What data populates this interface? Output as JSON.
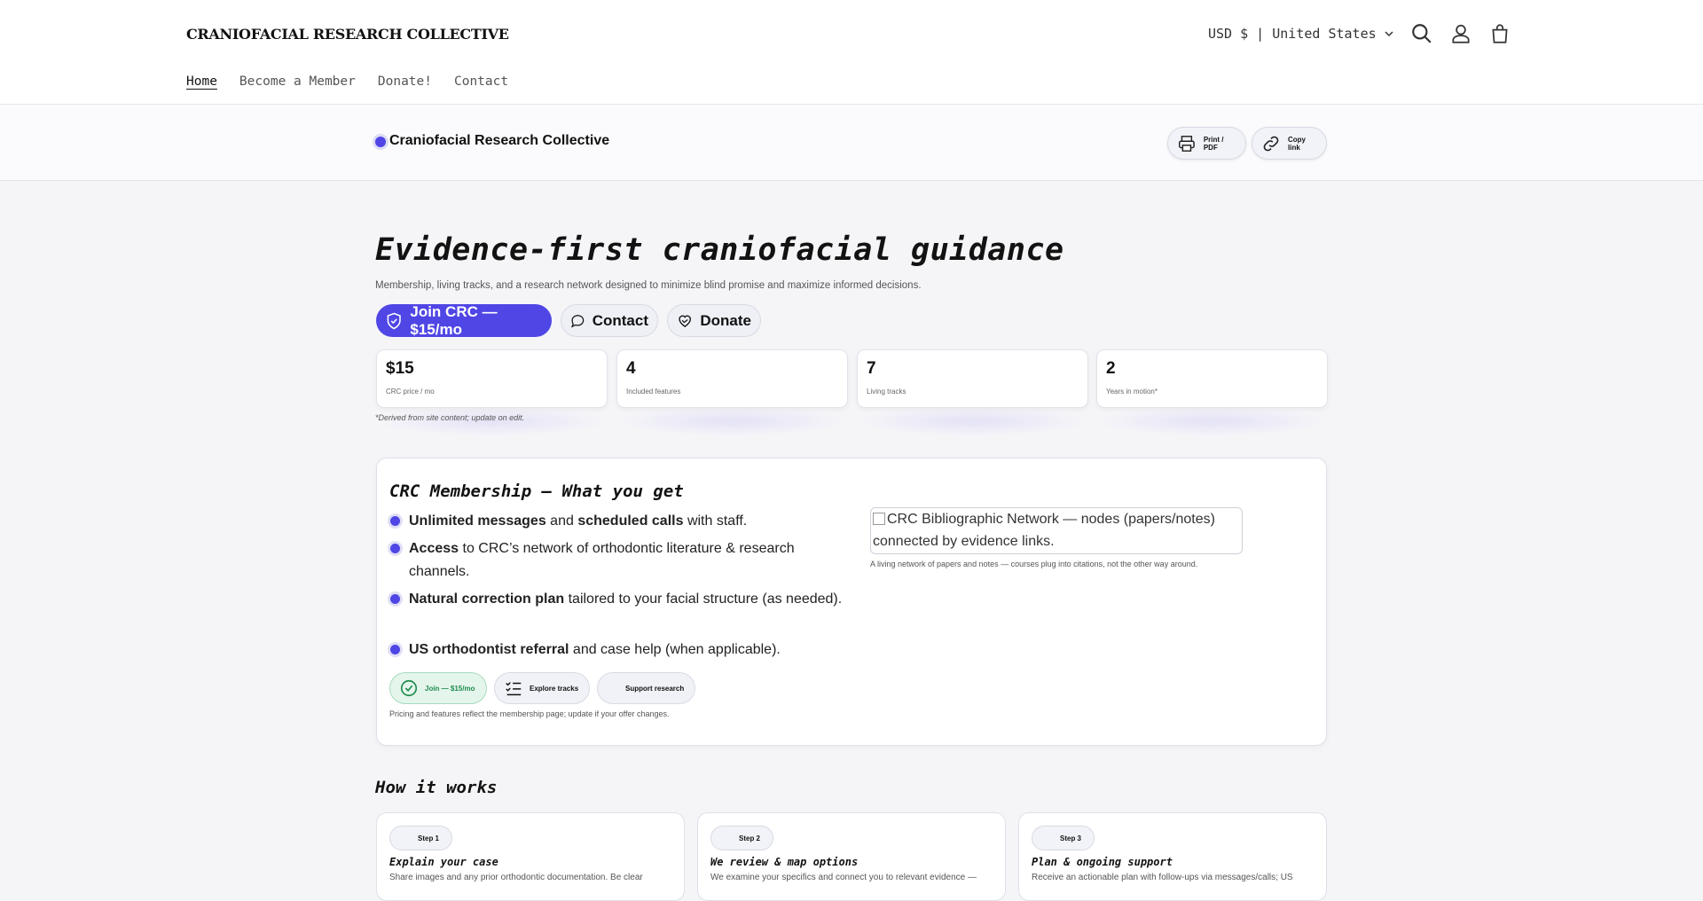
{
  "header": {
    "brand": "CRANIOFACIAL RESEARCH COLLECTIVE",
    "currency": "USD $ | United States",
    "nav": [
      "Home",
      "Become a Member",
      "Donate!",
      "Contact"
    ]
  },
  "subbar": {
    "title": "Craniofacial Research Collective",
    "print_label": "Print / PDF",
    "copy_label": "Copy link"
  },
  "hero": {
    "title": "Evidence-first craniofacial guidance",
    "subtitle": "Membership, living tracks, and a research network designed to minimize blind promise and maximize informed decisions.",
    "cta_join": "Join CRC — $15/mo",
    "cta_contact": "Contact",
    "cta_donate": "Donate",
    "stats": [
      {
        "value": "$15",
        "label": "CRC price / mo"
      },
      {
        "value": "4",
        "label": "Included features"
      },
      {
        "value": "7",
        "label": "Living tracks"
      },
      {
        "value": "2",
        "label": "Years in motion*"
      }
    ],
    "footnote": "*Derived from site content; update on edit."
  },
  "membership": {
    "title": "CRC Membership — What you get",
    "features": [
      {
        "bold1": "Unlimited messages",
        "mid": " and ",
        "bold2": "scheduled calls",
        "rest": " with staff."
      },
      {
        "bold1": "Access",
        "mid": " to CRC’s network of orthodontic literature & research channels.",
        "bold2": "",
        "rest": ""
      },
      {
        "bold1": "Natural correction plan",
        "mid": " tailored to your facial structure (as needed).",
        "bold2": "",
        "rest": ""
      },
      {
        "bold1": "US orthodontist referral",
        "mid": " and case help (when applicable).",
        "bold2": "",
        "rest": ""
      }
    ],
    "btn_join": "Join — $15/mo",
    "btn_tracks": "Explore tracks",
    "btn_support": "Support research",
    "note": "Pricing and features reflect the membership page; update if your offer changes.",
    "image_alt": "CRC Bibliographic Network — nodes (papers/notes) connected by evidence links.",
    "image_caption": "A living network of papers and notes — courses plug into citations, not the other way around."
  },
  "how": {
    "title": "How it works",
    "steps": [
      {
        "pill": "Step 1",
        "title": "Explain your case",
        "text": "Share images and any prior orthodontic documentation. Be clear"
      },
      {
        "pill": "Step 2",
        "title": "We review & map options",
        "text": "We examine your specifics and connect you to relevant evidence —"
      },
      {
        "pill": "Step 3",
        "title": "Plan & ongoing support",
        "text": "Receive an actionable plan with follow-ups via messages/calls; US"
      }
    ]
  },
  "colors": {
    "accent": "#4f46e5",
    "success": "#1f8b4c"
  }
}
